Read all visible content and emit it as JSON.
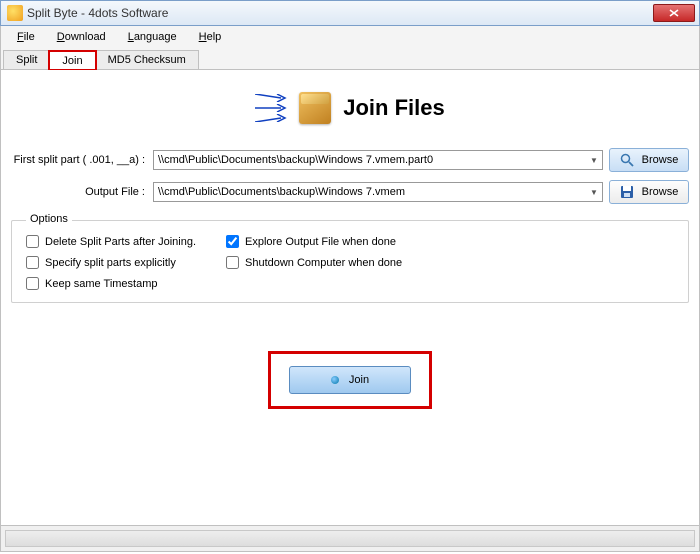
{
  "window": {
    "title": "Split Byte - 4dots Software"
  },
  "menu": {
    "file": "File",
    "download": "Download",
    "language": "Language",
    "help": "Help"
  },
  "tabs": {
    "split": "Split",
    "join": "Join",
    "md5": "MD5 Checksum"
  },
  "hero": {
    "title": "Join Files"
  },
  "inputs": {
    "first_label": "First split part ( .001, __a) :",
    "first_value": "\\\\cmd\\Public\\Documents\\backup\\Windows 7.vmem.part0",
    "output_label": "Output File :",
    "output_value": "\\\\cmd\\Public\\Documents\\backup\\Windows 7.vmem",
    "browse": "Browse"
  },
  "options": {
    "legend": "Options",
    "delete_parts": "Delete Split Parts after Joining.",
    "explore_output": "Explore Output File when done",
    "specify_explicit": "Specify split parts explicitly",
    "shutdown": "Shutdown Computer when done",
    "keep_timestamp": "Keep same Timestamp"
  },
  "actions": {
    "join": "Join"
  }
}
